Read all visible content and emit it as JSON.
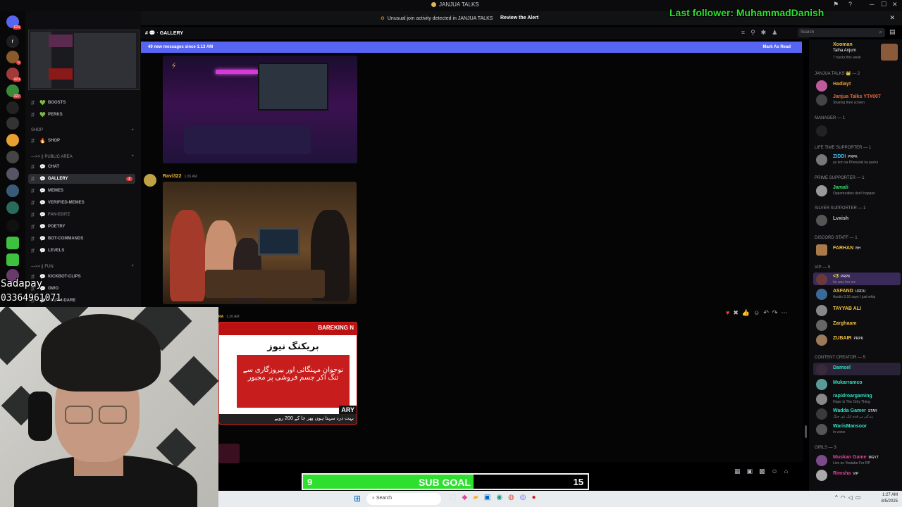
{
  "window": {
    "title": "JANJUA TALKS",
    "controls": [
      "─",
      "☐",
      "✕"
    ]
  },
  "alert": {
    "message": "Unusual join activity detected in JANJUA TALKS",
    "action": "Review the Alert"
  },
  "overlay": {
    "last_follower": "Last follower: MuhammadDanish",
    "name": "Sadapay",
    "phone": "03364961071"
  },
  "channel_header": {
    "name": "GALLERY",
    "search_placeholder": "Search"
  },
  "new_messages": {
    "text": "49 new messages since 1:13 AM",
    "mark_read": "Mark As Read"
  },
  "servers": [
    {
      "badge": "624"
    },
    {
      "badge": "r"
    },
    {
      "badge": "6"
    },
    {
      "badge": "470"
    },
    {
      "badge": "327"
    }
  ],
  "sidebar": {
    "channels": [
      {
        "label": "BOOSTS",
        "emoji": "💚"
      },
      {
        "label": "PERKS",
        "emoji": "💚"
      },
      {
        "label": "SHOP",
        "emoji": "🔥"
      },
      {
        "label": "CHAT",
        "emoji": "💬"
      },
      {
        "label": "GALLERY",
        "emoji": "💬",
        "unread": "2"
      },
      {
        "label": "MEMES",
        "emoji": "💬"
      },
      {
        "label": "VERIFIED-MEMES",
        "emoji": "💬"
      },
      {
        "label": "FAN-EDITZ",
        "emoji": "💬"
      },
      {
        "label": "POETRY",
        "emoji": "💬"
      },
      {
        "label": "BOT-COMMANDS",
        "emoji": "💬"
      },
      {
        "label": "LEVELS",
        "emoji": "💬"
      },
      {
        "label": "KICKBOT-CLIPS",
        "emoji": "💬"
      },
      {
        "label": "OWO",
        "emoji": "💬"
      },
      {
        "label": "TRUTH-DARE",
        "emoji": "💬"
      }
    ],
    "categories": {
      "shop": "SHOP",
      "public": "—>> ∥ PUBLIC AREA",
      "fun": "—>> ∥ FUN"
    }
  },
  "messages": [
    {
      "author": "Ravi322",
      "time": "1:26 AM"
    },
    {
      "author": "RA",
      "time": "1:26 AM"
    }
  ],
  "news_image": {
    "breaking": "BAREKING N",
    "headline": "بریکنگ نیوز",
    "body": "نوجوان مہنگائی اور بیروزگاری سے تنگ آکر جسم فروشی پر مجبور",
    "footer": "بہت درد سہتا ہوں پھر جا کے 200 روپے",
    "channel": "ARY"
  },
  "members": {
    "top": {
      "name": "Xooman",
      "sub": "Talha Anjum",
      "status": "7 tracks this week"
    },
    "groups": [
      {
        "title": "JANJUA TALKS 👑 — 2",
        "members": [
          {
            "name": "Hadiayt",
            "color": "#e8a23c"
          },
          {
            "name": "Janjua Talks YT#007",
            "color": "#e06a3a",
            "status": "Sharing their screen"
          }
        ]
      },
      {
        "title": "Manager — 1",
        "members": []
      },
      {
        "title": "Life Time Supporter — 1",
        "members": [
          {
            "name": "ZIDDI",
            "color": "#3ec1f0",
            "tag": "PRPK",
            "status": "ye kon sa Phenyski ka packs"
          }
        ]
      },
      {
        "title": "Prime Supporter — 1",
        "members": [
          {
            "name": "Jamali",
            "color": "#2ee06a",
            "status": "Opportunities don't happen"
          }
        ]
      },
      {
        "title": "Silver Supporter — 1",
        "members": [
          {
            "name": "Lvxish",
            "color": "#c8c8c8"
          }
        ]
      },
      {
        "title": "DISCORD STAFF — 1",
        "members": [
          {
            "name": "FARHAN",
            "color": "#f0c040",
            "tag": "BH"
          }
        ]
      },
      {
        "title": "VIP — 5",
        "members": [
          {
            "name": "<3",
            "color": "#f0f040",
            "tag": "PRPK",
            "status": "he was her sis"
          },
          {
            "name": "ASFAND",
            "color": "#f0c040",
            "tag": "URDU",
            "status": "Austin 3:16 says I just whip"
          },
          {
            "name": "TAYYAB ALI",
            "color": "#f0c040"
          },
          {
            "name": "Zarghaam",
            "color": "#f0c040"
          },
          {
            "name": "ZUBAIR",
            "color": "#f0c040",
            "tag": "PRPK"
          }
        ]
      },
      {
        "title": "Content Creator — 5",
        "members": [
          {
            "name": "Damsel",
            "color": "#2ee0c0"
          },
          {
            "name": "Mukarramco",
            "color": "#2ee0c0"
          },
          {
            "name": "rapidroargaming",
            "color": "#2ee0c0",
            "status": "Hope Is The Only Thing"
          },
          {
            "name": "Wadda Gamer",
            "color": "#2ee0c0",
            "tag": "STAR",
            "status": "زندگی ہر قدم ایک نئی جنگ"
          },
          {
            "name": "WarisMansoor",
            "color": "#2ee0c0",
            "status": "In voice"
          }
        ]
      },
      {
        "title": "GIRLS — 3",
        "members": [
          {
            "name": "Muskan Game",
            "color": "#e0409a",
            "tag": "MGYT",
            "status": "Live on Youtube For RP"
          },
          {
            "name": "Rimsha",
            "color": "#e0409a",
            "tag": "VIP"
          }
        ]
      }
    ]
  },
  "sub_goal": {
    "label": "SUB GOAL",
    "current": "9",
    "target": "15",
    "progress": 0.6
  },
  "taskbar": {
    "search": "Search",
    "time": "1:27 AM",
    "date": "8/5/2025"
  },
  "colors": {
    "accent": "#5865f2",
    "goal_green": "#2ee02e",
    "alert": "#e23c3c"
  }
}
